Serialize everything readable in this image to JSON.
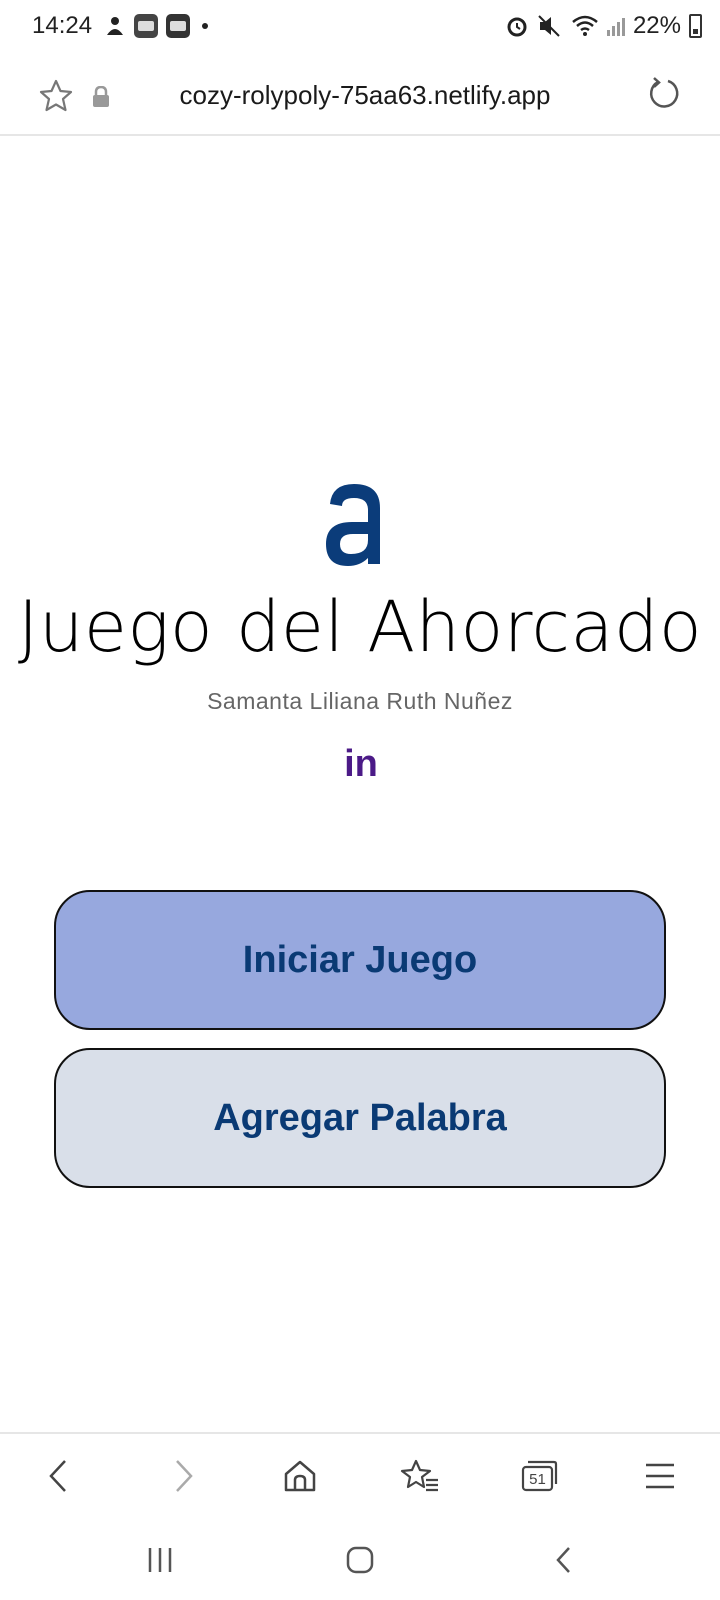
{
  "status_bar": {
    "time": "14:24",
    "battery_percent": "22%",
    "icons": [
      "person-icon",
      "burger-king-app-icon",
      "news-app-icon",
      "alarm-icon",
      "mute-icon",
      "wifi-icon",
      "signal-icon",
      "battery-icon"
    ]
  },
  "browser": {
    "url": "cozy-rolypoly-75aa63.netlify.app",
    "icons": [
      "star-icon",
      "lock-icon",
      "reload-icon"
    ],
    "toolbar_tab_count": "51"
  },
  "page": {
    "logo_letter": "a",
    "title": "Juego del Ahorcado",
    "author": "Samanta Liliana Ruth Nuñez",
    "linkedin_label": "in",
    "start_button": "Iniciar Juego",
    "add_word_button": "Agregar Palabra"
  },
  "colors": {
    "logo_blue": "#0b3c7a",
    "linkedin_purple": "#4b1a87",
    "start_bg": "#97a8de",
    "add_bg": "#d9dfe9",
    "button_text": "#0a3a74"
  }
}
